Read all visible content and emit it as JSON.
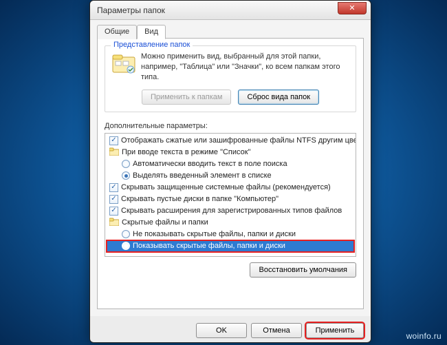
{
  "window": {
    "title": "Параметры папок"
  },
  "tabs": {
    "general": "Общие",
    "view": "Вид"
  },
  "group": {
    "legend": "Представление папок",
    "text": "Можно применить вид, выбранный для этой папки, например, \"Таблица\" или \"Значки\", ко всем папкам этого типа.",
    "apply_btn": "Применить к папкам",
    "reset_btn": "Сброс вида папок"
  },
  "adv_label": "Дополнительные параметры:",
  "tree": {
    "items": [
      {
        "type": "checkbox",
        "checked": true,
        "indent": 0,
        "label": "Отображать сжатые или зашифрованные файлы NTFS другим цветом"
      },
      {
        "type": "folder",
        "indent": 0,
        "label": "При вводе текста в режиме \"Список\""
      },
      {
        "type": "radio",
        "checked": false,
        "indent": 1,
        "label": "Автоматически вводить текст в поле поиска"
      },
      {
        "type": "radio",
        "checked": true,
        "indent": 1,
        "label": "Выделять введенный элемент в списке"
      },
      {
        "type": "checkbox",
        "checked": true,
        "indent": 0,
        "label": "Скрывать защищенные системные файлы (рекомендуется)"
      },
      {
        "type": "checkbox",
        "checked": true,
        "indent": 0,
        "label": "Скрывать пустые диски в папке \"Компьютер\""
      },
      {
        "type": "checkbox",
        "checked": true,
        "indent": 0,
        "label": "Скрывать расширения для зарегистрированных типов файлов"
      },
      {
        "type": "folder",
        "indent": 0,
        "label": "Скрытые файлы и папки"
      },
      {
        "type": "radio",
        "checked": false,
        "indent": 1,
        "label": "Не показывать скрытые файлы, папки и диски"
      },
      {
        "type": "radio",
        "checked": true,
        "indent": 1,
        "label": "Показывать скрытые файлы, папки и диски",
        "selected": true
      }
    ]
  },
  "restore_btn": "Восстановить умолчания",
  "buttons": {
    "ok": "OK",
    "cancel": "Отмена",
    "apply": "Применить"
  },
  "watermark": "woinfo.ru"
}
